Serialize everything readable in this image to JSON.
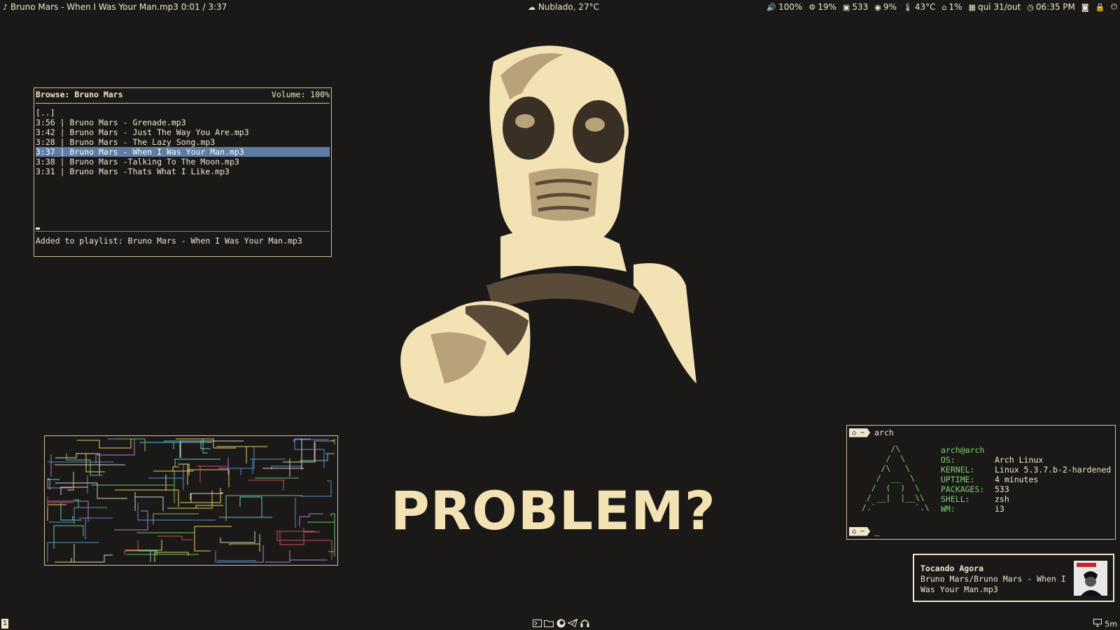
{
  "topbar": {
    "now_playing": "Bruno Mars - When I Was Your Man.mp3 0:01 / 3:37",
    "weather": "Nublado, 27°C",
    "volume": "100%",
    "cpu": "19%",
    "packages": "533",
    "memory": "9%",
    "temperature": "43°C",
    "disk": "1%",
    "date": "qui 31/out",
    "time": "06:35 PM"
  },
  "ncmpcpp": {
    "header_title": "Browse: Bruno Mars",
    "volume_label": "Volume: 100%",
    "parent_dir": "[..]",
    "items": [
      {
        "text": "3:56 | Bruno Mars - Grenade.mp3",
        "selected": false
      },
      {
        "text": "3:42 | Bruno Mars - Just The Way You Are.mp3",
        "selected": false
      },
      {
        "text": "3:28 | Bruno Mars - The Lazy Song.mp3",
        "selected": false
      },
      {
        "text": "3:37 | Bruno Mars - When I Was Your Man.mp3",
        "selected": true
      },
      {
        "text": "3:38 | Bruno Mars -Talking To The Moon.mp3",
        "selected": false
      },
      {
        "text": "3:31 | Bruno Mars -Thats What I Like.mp3",
        "selected": false
      }
    ],
    "status": "Added to playlist: Bruno Mars - When I Was Your Man.mp3"
  },
  "wallpaper": {
    "text": "PROBLEM?",
    "colors": {
      "cream": "#f3e2b3",
      "mid": "#b8a27a",
      "dark": "#5a4a38",
      "bg": "#1b1918"
    }
  },
  "neofetch": {
    "prompt_dir": "~",
    "command": "arch",
    "user_host": "arch@arch",
    "fields": [
      {
        "key": "OS:",
        "value": "Arch Linux"
      },
      {
        "key": "KERNEL:",
        "value": "Linux 5.3.7.b-2-hardened"
      },
      {
        "key": "UPTIME:",
        "value": "4 minutes"
      },
      {
        "key": "PACKAGES:",
        "value": "533"
      },
      {
        "key": "SHELL:",
        "value": "zsh"
      },
      {
        "key": "WM:",
        "value": "i3"
      }
    ],
    "cursor": "_",
    "logo_lines": [
      "       /\\",
      "      /  \\",
      "     /\\   \\",
      "    /  __  \\",
      "   /  (  )  \\",
      "  / __|  |__\\\\",
      " /.`        `.\\"
    ]
  },
  "notification": {
    "title": "Tocando Agora",
    "body": "Bruno Mars/Bruno Mars - When I Was Your Man.mp3"
  },
  "bottombar": {
    "workspace": "1",
    "dock_icons": [
      "terminal-icon",
      "folder-icon",
      "firefox-icon",
      "telegram-icon",
      "headphones-icon"
    ],
    "right_label": "5m"
  },
  "theme": {
    "accent": "#f0e6cf",
    "selection": "#5f7da3",
    "green": "#7bd36c"
  }
}
